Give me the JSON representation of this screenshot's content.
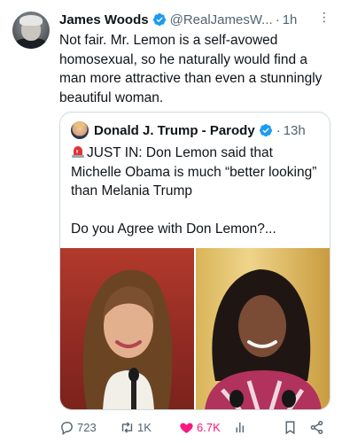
{
  "tweet": {
    "author_name": "James Woods",
    "handle": "@RealJamesW...",
    "dot": "·",
    "time": "1h",
    "more": "⋮",
    "text": "Not fair. Mr. Lemon is a self-avowed homosexual, so he naturally would find a man more attractive than even a stunningly beautiful woman."
  },
  "quote": {
    "author_name": "Donald J. Trump - Parody",
    "dot": "·",
    "time": "13h",
    "line1": "JUST IN: Don Lemon said that Michelle Obama is much “better looking” than Melania Trump",
    "line2": "Do you Agree with Don Lemon?..."
  },
  "actions": {
    "replies": "723",
    "retweets": "1K",
    "likes": "6.7K"
  },
  "colors": {
    "verified_blue": "#1d9bf0",
    "like_pink": "#f91880",
    "muted_gray": "#536471"
  },
  "icons": {
    "reply": "reply-icon",
    "retweet": "retweet-icon",
    "like": "heart-icon",
    "views": "views-icon",
    "bookmark": "bookmark-icon",
    "share": "share-icon"
  }
}
